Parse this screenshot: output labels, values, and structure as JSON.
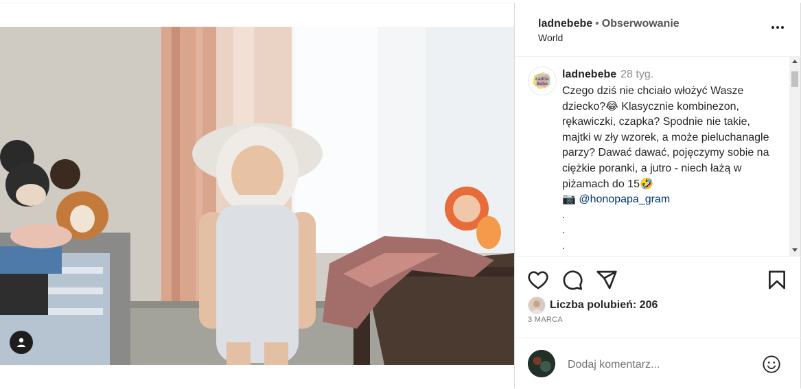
{
  "post": {
    "author": "ladnebebe",
    "separator": "•",
    "follow_label": "Obserwowanie",
    "location": "World"
  },
  "caption": {
    "username": "ladnebebe",
    "time_ago": "28 tyg.",
    "text_main": "Czego dziś nie chciało włożyć Wasze dziecko?😂 Klasycznie kombinezon, rękawiczki, czapka? Spodnie nie takie, majtki w zły wzorek, a może pieluchanagle parzy? Dawać dawać, pojęczymy sobie na ciężkie poranki, a jutro - niech łażą w piżamach do 15🤣",
    "camera_emoji": "📷",
    "mention": "@honopapa_gram",
    "dots": ".\n.\n."
  },
  "avatar_logo": {
    "line1": "Ładne",
    "line2": "Bebe"
  },
  "likes": {
    "text": "Liczba polubień: 206"
  },
  "date": "3 MARCA",
  "comment_box": {
    "placeholder": "Dodaj komentarz..."
  },
  "icons": {
    "like": "heart-icon",
    "comment": "comment-icon",
    "share": "share-icon",
    "save": "bookmark-icon",
    "more": "more-icon",
    "emoji": "emoji-icon",
    "user_tag": "user-tag-icon"
  },
  "colors": {
    "text": "#262626",
    "muted": "#737373",
    "mention": "#00376b",
    "border": "#dbdbdb"
  }
}
